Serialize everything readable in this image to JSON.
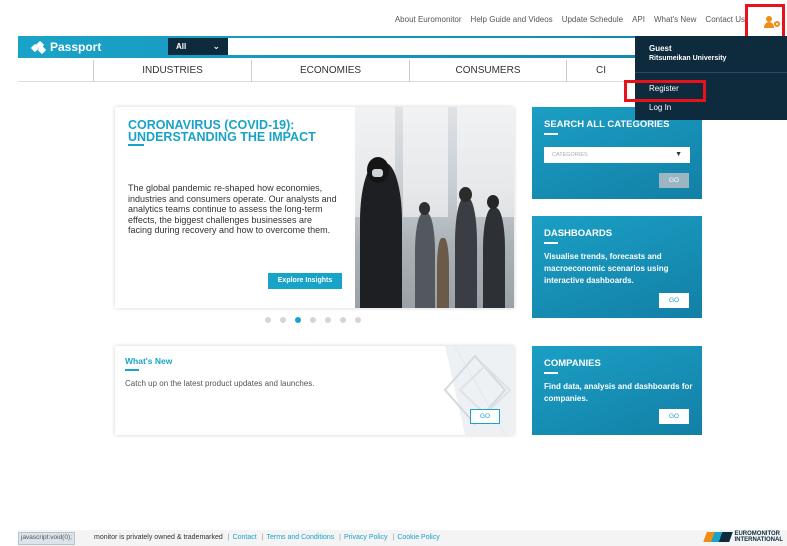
{
  "util_links": [
    "About Euromonitor",
    "Help Guide and Videos",
    "Update Schedule",
    "API",
    "What's New",
    "Contact Us"
  ],
  "brand": "Passport",
  "search": {
    "scope": "All",
    "placeholder": ""
  },
  "categories": [
    "INDUSTRIES",
    "ECONOMIES",
    "CONSUMERS",
    "CI"
  ],
  "user_menu": {
    "guest": "Guest",
    "institution": "Ritsumeikan University",
    "register": "Register",
    "login": "Log In"
  },
  "hero": {
    "title": "CORONAVIRUS (COVID-19): UNDERSTANDING THE IMPACT",
    "body": "The global pandemic re-shaped how economies, industries and consumers operate. Our analysts and analytics teams continue to assess the long-term effects, the biggest challenges businesses are facing during recovery and how to overcome them.",
    "button": "Explore Insights",
    "carousel_count": 7,
    "carousel_active": 2
  },
  "whats_new": {
    "title": "What's New",
    "body": "Catch up on the latest product updates and launches.",
    "button": "GO"
  },
  "search_all": {
    "title": "SEARCH ALL CATEGORIES",
    "select_placeholder": "CATEGORIES",
    "button": "GO"
  },
  "dashboards": {
    "title": "DASHBOARDS",
    "body": "Visualise trends, forecasts and macroeconomic scenarios using interactive dashboards.",
    "button": "GO"
  },
  "companies": {
    "title": "COMPANIES",
    "body": "Find data, analysis and dashboards for companies.",
    "button": "GO"
  },
  "footer": {
    "status": "javascript:void(0);",
    "text": "monitor is privately owned & trademarked",
    "links": [
      "Contact",
      "Terms and Conditions",
      "Privacy Policy",
      "Cookie Policy"
    ],
    "logo_line1": "EUROMONITOR",
    "logo_line2": "INTERNATIONAL"
  },
  "colors": {
    "brand_blue": "#1aa3c8",
    "dark_navy": "#0e2a3d",
    "highlight_red": "#e8121b",
    "user_orange": "#f08c1a"
  }
}
